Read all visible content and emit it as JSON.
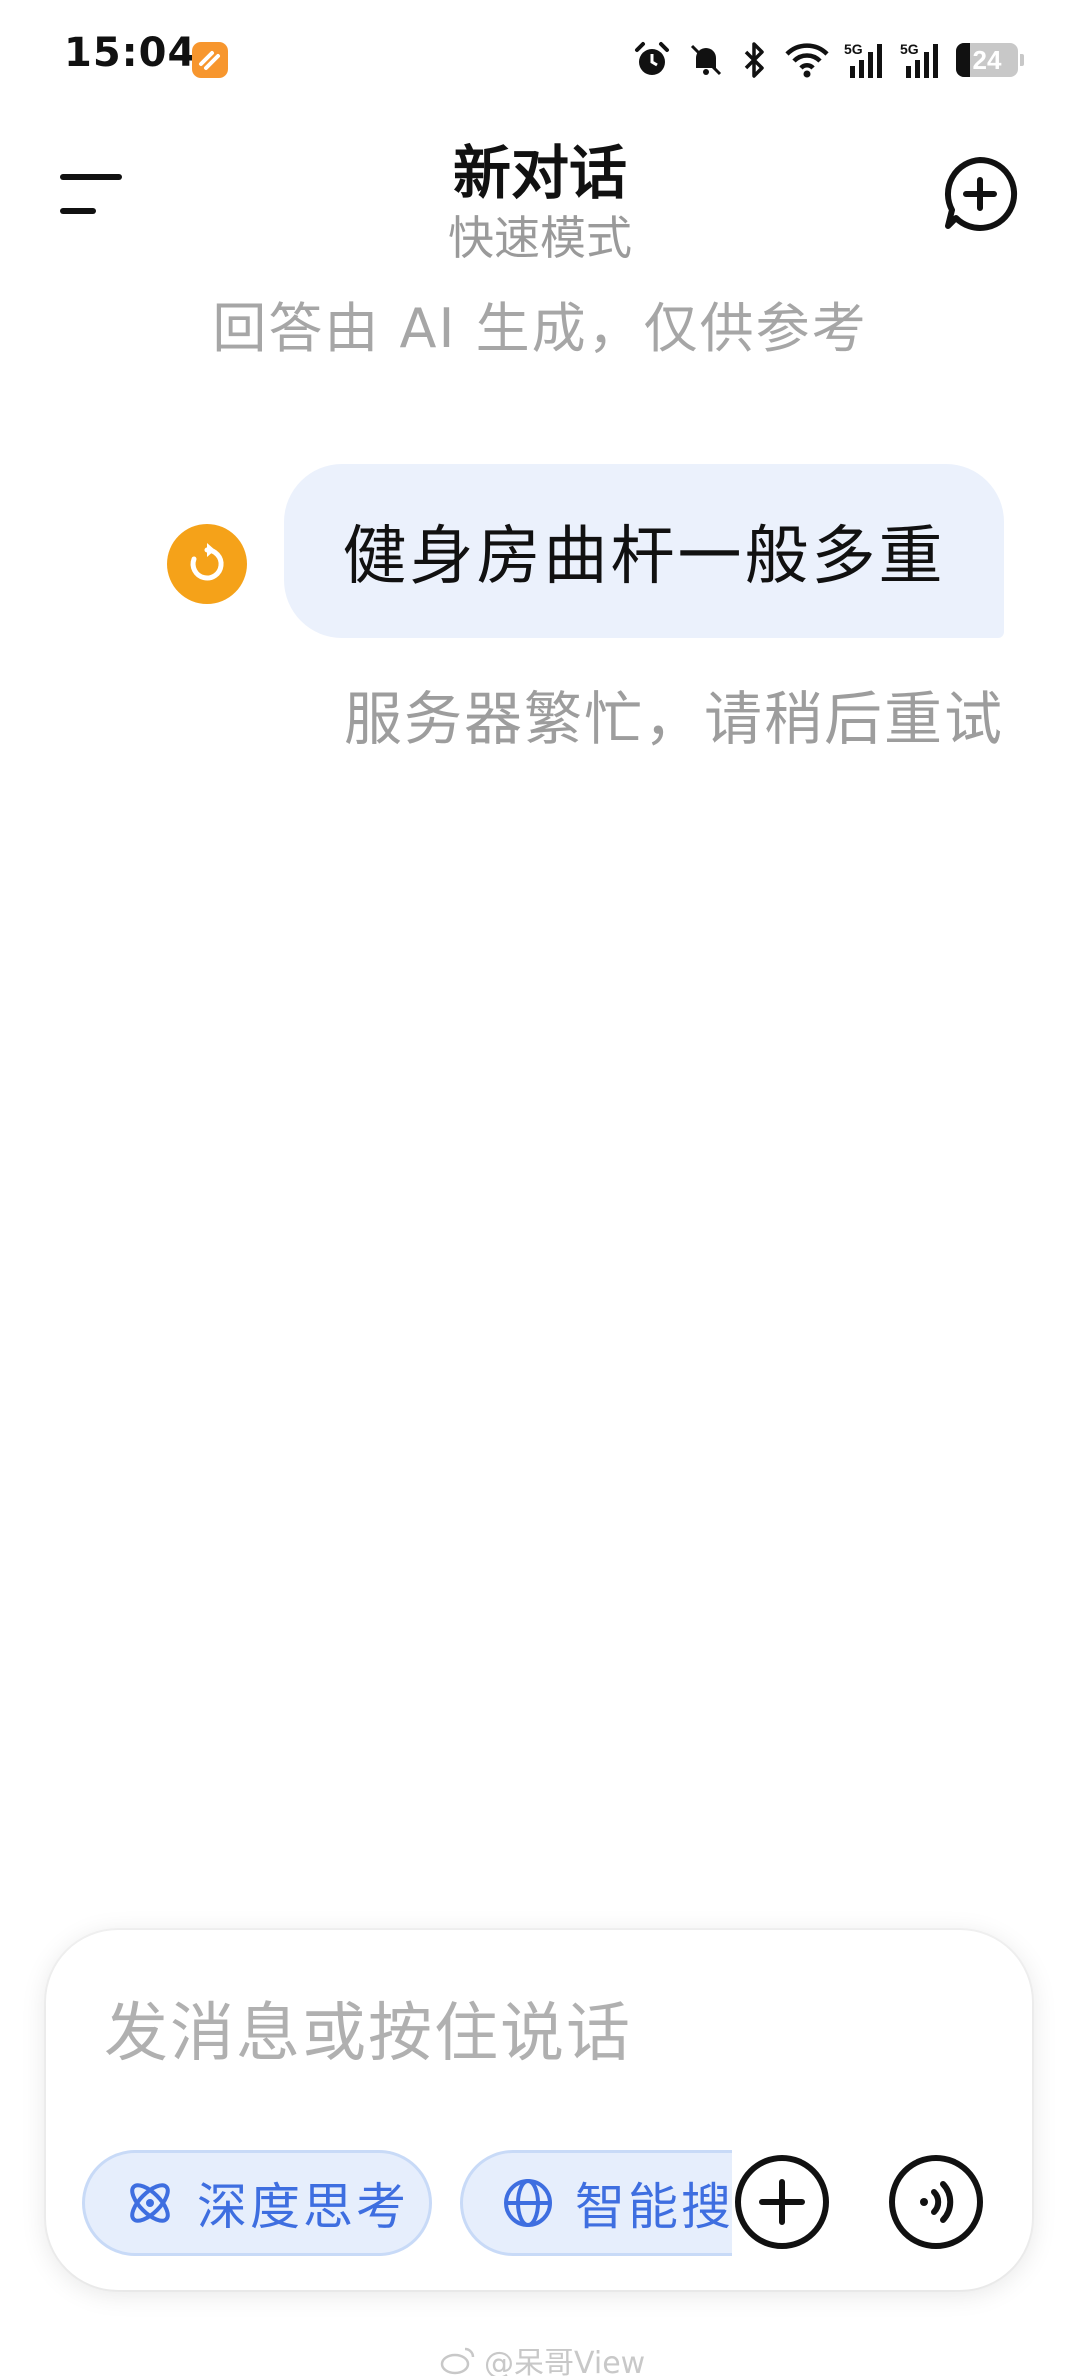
{
  "status_bar": {
    "time": "15:04",
    "battery_level": "24",
    "icons": [
      "app-notification-icon",
      "alarm-icon",
      "mute-icon",
      "bluetooth-icon",
      "wifi-icon",
      "signal-5g-icon",
      "signal-5g-icon",
      "battery-icon"
    ]
  },
  "header": {
    "title": "新对话",
    "subtitle": "快速模式",
    "menu_icon": "menu-icon",
    "new_chat_icon": "new-chat-icon"
  },
  "disclaimer": "回答由 AI 生成，仅供参考",
  "conversation": {
    "user_message": "健身房曲杆一般多重",
    "retry_icon": "retry-icon",
    "error_message": "服务器繁忙，请稍后重试"
  },
  "composer": {
    "placeholder": "发消息或按住说话",
    "chips": [
      {
        "label": "深度思考",
        "icon": "atom-icon"
      },
      {
        "label": "智能搜索",
        "icon": "globe-icon"
      }
    ],
    "attach_icon": "plus-circle-icon",
    "voice_icon": "voice-icon"
  },
  "watermark": "@呆哥View",
  "colors": {
    "accent_blue": "#3e6ee0",
    "chip_bg": "#e6eefc",
    "bubble_bg": "#ebf1fc",
    "retry_orange": "#f5a219",
    "muted_text": "#9d9d9d"
  }
}
